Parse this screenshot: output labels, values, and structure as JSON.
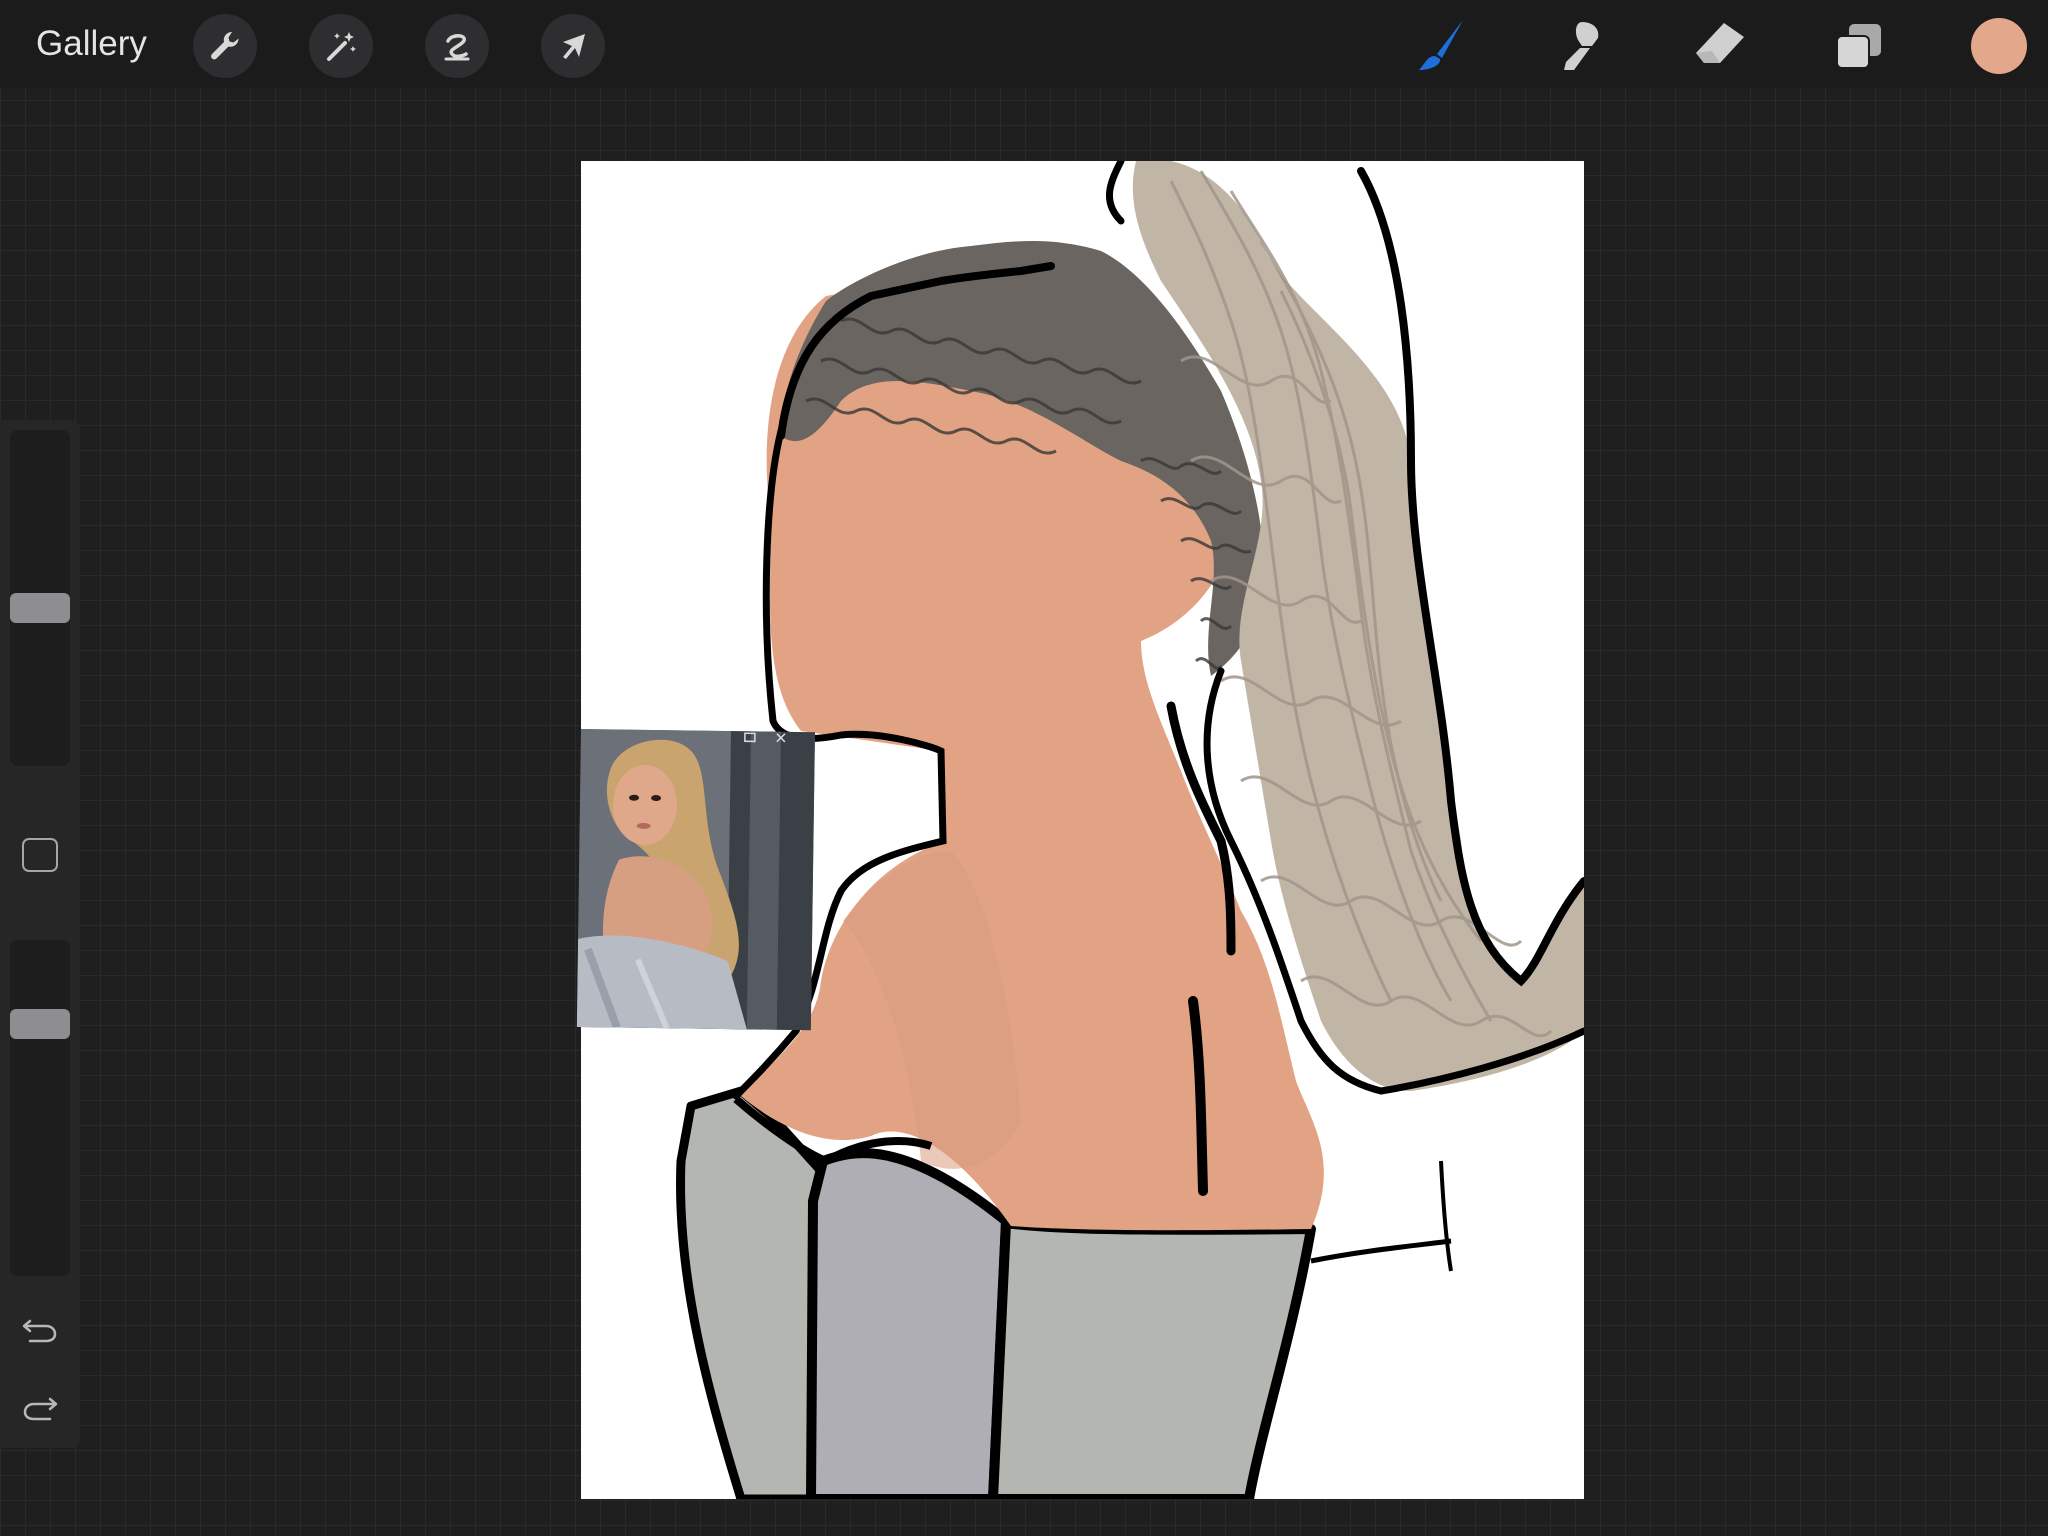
{
  "toolbar": {
    "gallery_label": "Gallery",
    "left_tools": [
      {
        "name": "actions",
        "icon": "wrench-icon"
      },
      {
        "name": "adjustments",
        "icon": "magic-wand-icon"
      },
      {
        "name": "selection",
        "icon": "selection-s-icon"
      },
      {
        "name": "transform",
        "icon": "arrow-cursor-icon"
      }
    ],
    "right_tools": [
      {
        "name": "brush",
        "icon": "brush-icon",
        "active": true
      },
      {
        "name": "smudge",
        "icon": "smudge-icon",
        "active": false
      },
      {
        "name": "eraser",
        "icon": "eraser-icon",
        "active": false
      },
      {
        "name": "layers",
        "icon": "layers-icon",
        "active": false
      }
    ],
    "current_color": "#e3a78b",
    "active_tool_color": "#1e6fd9"
  },
  "sidebar": {
    "brush_size": 0.5,
    "brush_opacity": 0.25,
    "undo_icon": "undo-icon",
    "redo_icon": "redo-icon",
    "modify_icon": "square-modify-icon"
  },
  "canvas": {
    "skin_color": "#e2a385",
    "hair_light_color": "#bdb1a2",
    "hair_dark_color": "#57534f",
    "dress_color": "#b4b6b1",
    "sleeve_color": "#afaeb4",
    "outline_color": "#000000"
  },
  "reference": {
    "kind": "reference-photo-window"
  }
}
